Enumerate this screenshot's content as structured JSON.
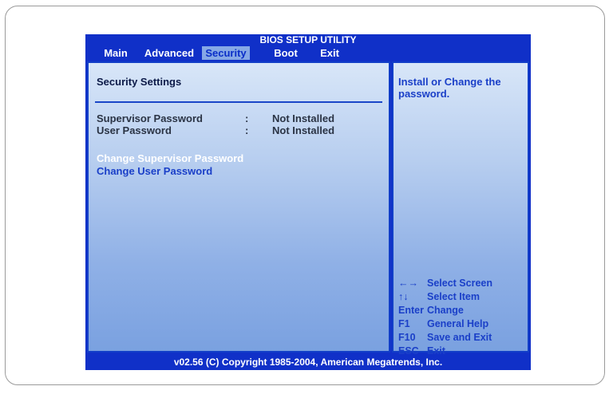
{
  "title": "BIOS SETUP UTILITY",
  "tabs": [
    {
      "label": "Main"
    },
    {
      "label": "Advanced"
    },
    {
      "label": "Security"
    },
    {
      "label": "Boot"
    },
    {
      "label": "Exit"
    }
  ],
  "active_tab": "Security",
  "main": {
    "section_title": "Security Settings",
    "status_rows": [
      {
        "label": "Supervisor Password",
        "separator": ":",
        "value": "Not Installed"
      },
      {
        "label": "User Password",
        "separator": ":",
        "value": "Not Installed"
      }
    ],
    "options": [
      {
        "label": "Change Supervisor Password"
      },
      {
        "label": "Change User Password"
      }
    ]
  },
  "help": {
    "text": "Install or Change the password."
  },
  "key_legend": [
    {
      "key": "←→",
      "action": "Select Screen"
    },
    {
      "key": "↑↓",
      "action": "Select Item"
    },
    {
      "key": "Enter",
      "action": "Change"
    },
    {
      "key": "F1",
      "action": "General Help"
    },
    {
      "key": "F10",
      "action": "Save and Exit"
    },
    {
      "key": "ESC",
      "action": "Exit"
    }
  ],
  "footer": "v02.56 (C) Copyright  1985-2004, American Megatrends, Inc.",
  "colors": {
    "bios_blue": "#1030c8",
    "active_tab_bg": "#86a8e6",
    "highlight_option": "#ffffff",
    "option_text": "#1a3fc8",
    "help_text": "#1a3fc8",
    "static_text": "#2a3344"
  }
}
